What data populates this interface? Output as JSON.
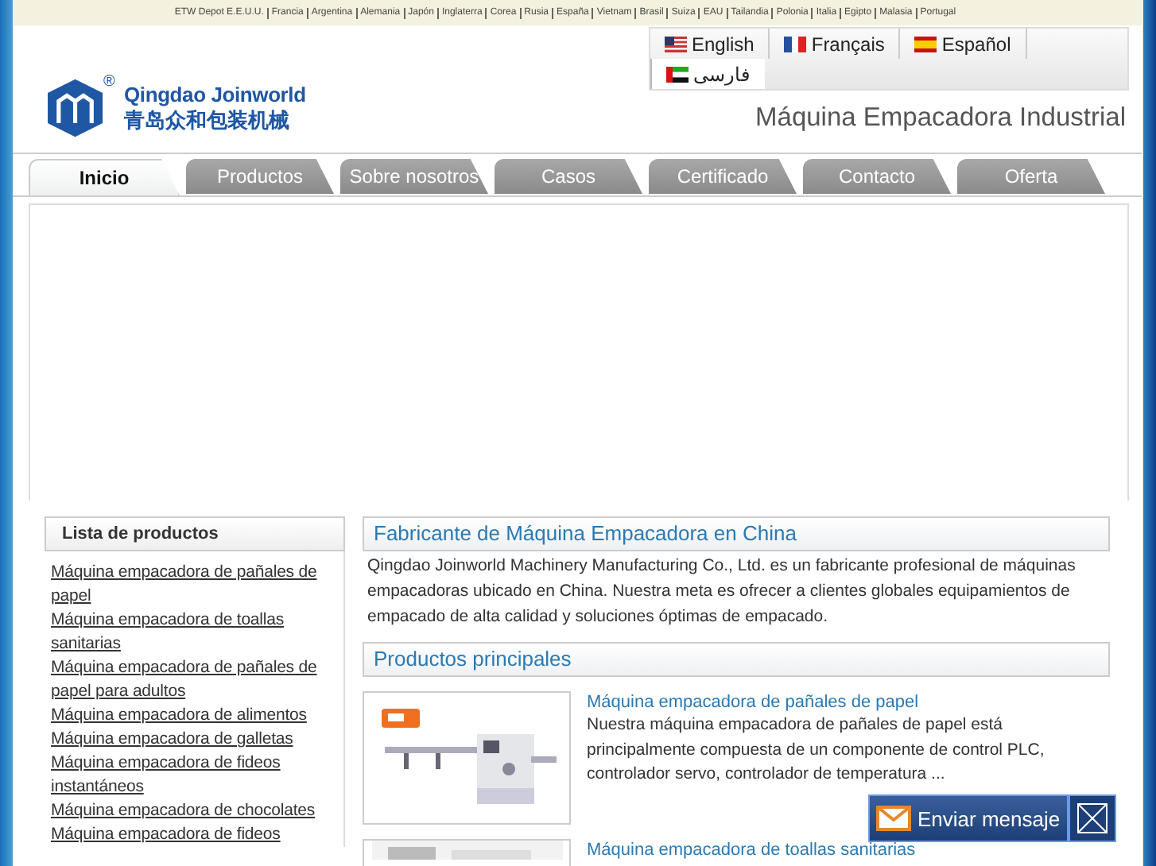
{
  "countries": [
    "ETW Depot E.E.U.U.",
    "Francia",
    "Argentina",
    "Alemania",
    "Japón",
    "Inglaterra",
    "Corea",
    "Rusia",
    "España",
    "Vietnam",
    "Brasil",
    "Suiza",
    "EAU",
    "Tailandia",
    "Polonia",
    "Italia",
    "Egipto",
    "Malasia",
    "Portugal"
  ],
  "languages": [
    {
      "label": "English"
    },
    {
      "label": "Français"
    },
    {
      "label": "Español"
    },
    {
      "label": "فارسی"
    }
  ],
  "logo": {
    "name": "Qingdao Joinworld",
    "chinese": "青岛众和包装机械",
    "mark": "®"
  },
  "tagline": "Máquina Empacadora Industrial",
  "tabs": [
    {
      "label": "Inicio",
      "selected": true
    },
    {
      "label": "Productos",
      "selected": false
    },
    {
      "label": "Sobre nosotros",
      "selected": false
    },
    {
      "label": "Casos",
      "selected": false
    },
    {
      "label": "Certificado",
      "selected": false
    },
    {
      "label": "Contacto",
      "selected": false
    },
    {
      "label": "Oferta",
      "selected": false
    }
  ],
  "sidebar": {
    "title": "Lista de productos",
    "items": [
      "Máquina empacadora de pañales de papel",
      "Máquina empacadora de toallas sanitarias",
      "Máquina empacadora de pañales de papel para adultos",
      "Máquina empacadora de alimentos",
      "Máquina empacadora de galletas",
      "Máquina empacadora de fideos instantáneos",
      "Máquina empacadora de chocolates",
      "Máquina empacadora de fideos"
    ]
  },
  "intro": {
    "title": "Fabricante de Máquina Empacadora en China",
    "text": "Qingdao Joinworld Machinery Manufacturing Co., Ltd. es un fabricante profesional de máquinas empacadoras ubicado en China. Nuestra meta es ofrecer a clientes globales equipamientos de empacado de alta calidad y soluciones óptimas de empacado."
  },
  "products": {
    "title": "Productos principales",
    "items": [
      {
        "name": "Máquina empacadora de pañales de papel",
        "text": "Nuestra máquina empacadora de pañales de papel está principalmente compuesta de un componente de control PLC, controlador servo, controlador de temperatura ..."
      },
      {
        "name": "Máquina empacadora de toallas sanitarias"
      }
    ]
  },
  "message_button": {
    "label": "Enviar mensaje"
  }
}
